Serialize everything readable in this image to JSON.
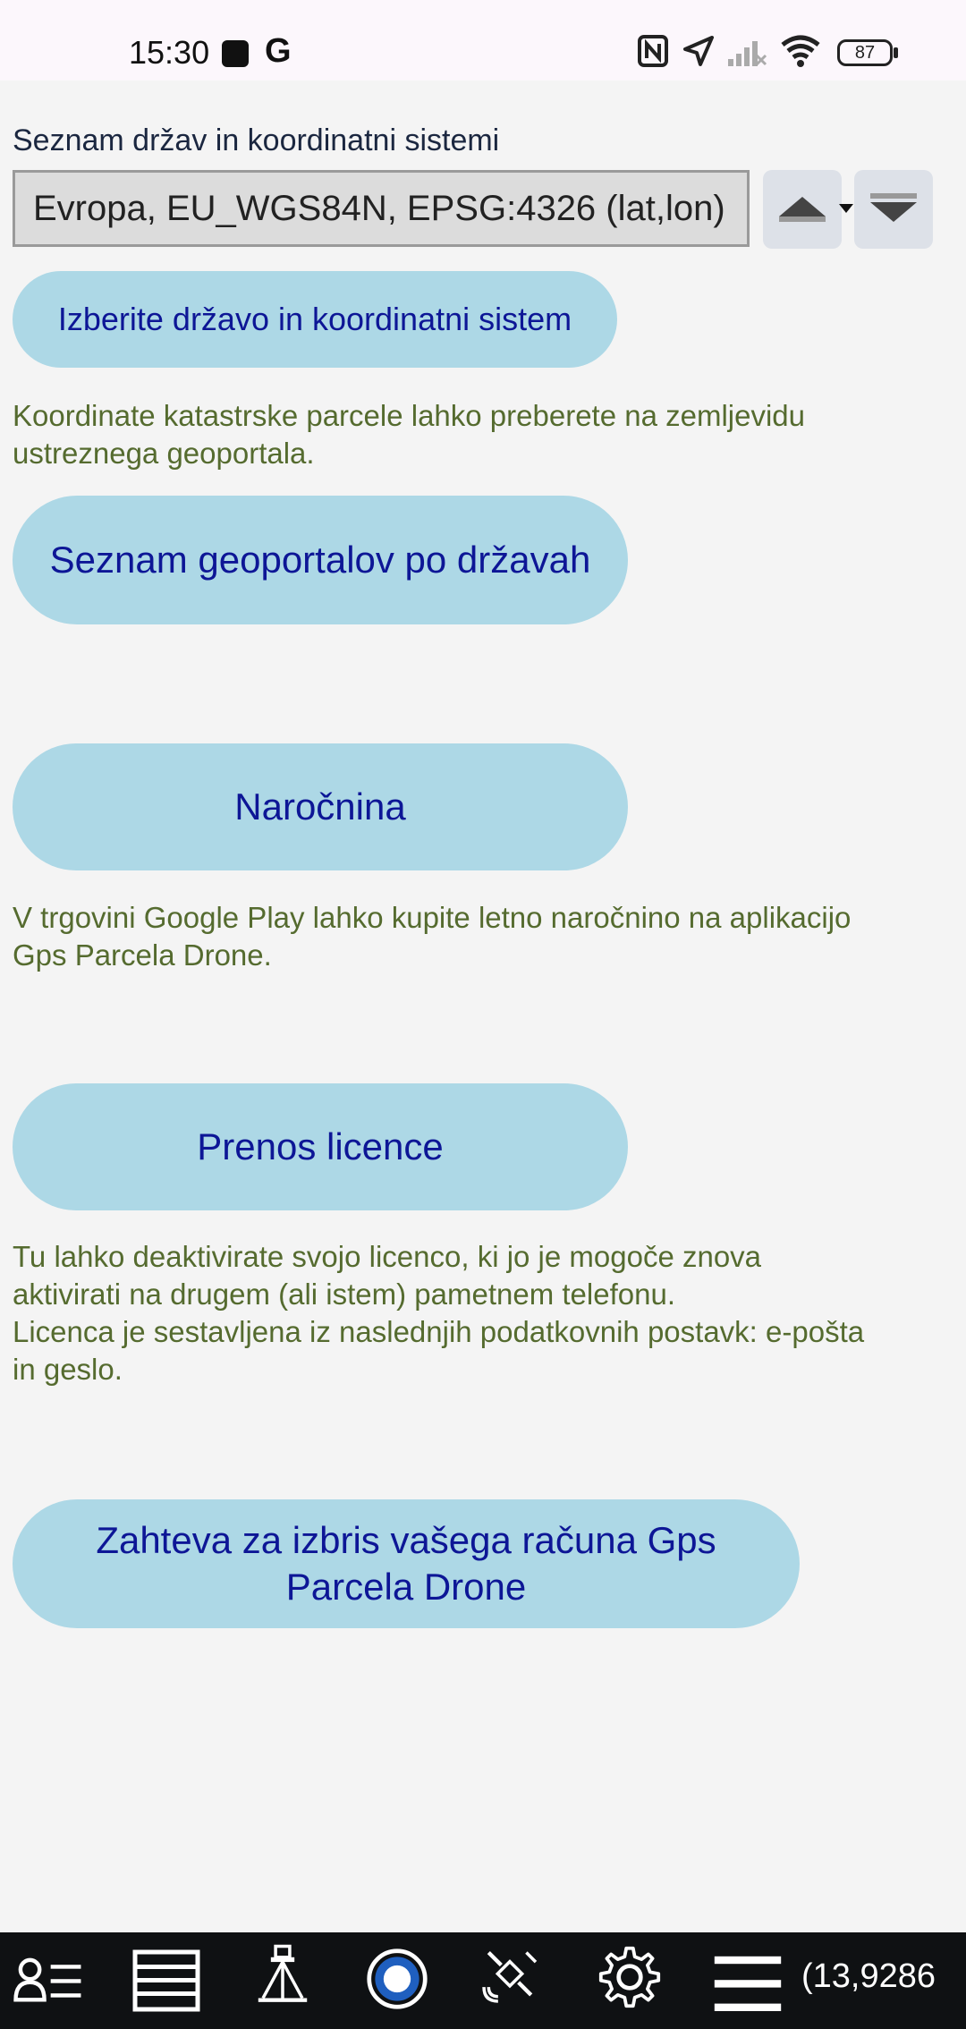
{
  "status_bar": {
    "time": "15:30",
    "g_label": "G",
    "battery": "87",
    "icons": [
      "nfc-icon",
      "location-arrow-icon",
      "no-signal-icon",
      "wifi-icon",
      "battery-icon"
    ]
  },
  "settings": {
    "country_label": "Seznam držav in koordinatni sistemi",
    "country_select_value": "Evropa, EU_WGS84N, EPSG:4326 (lat,lon)",
    "select_button": "Izberite državo in koordinatni sistem",
    "geoportal_note": "Koordinate katastrske parcele lahko preberete na zemljevidu\nustreznega geoportala.",
    "geoportal_button": "Seznam geoportalov po državah",
    "subscription_button": "Naročnina",
    "subscription_note": "V trgovini Google Play lahko kupite letno naročnino na aplikacijo\nGps Parcela Drone.",
    "license_button": "Prenos licence",
    "license_note": "Tu lahko deaktivirate svojo licenco, ki jo je mogoče znova\naktivirati na drugem (ali istem) pametnem telefonu.\nLicenca je sestavljena iz naslednjih podatkovnih postavk: e-pošta\nin geslo.",
    "delete_account_button": "Zahteva za izbris vašega računa Gps Parcela Drone"
  },
  "bottom_nav": {
    "items": [
      "user-list-icon",
      "layers-list-icon",
      "survey-instrument-icon",
      "record-circle-icon",
      "satellite-icon",
      "gear-icon",
      "hamburger-menu-icon"
    ],
    "coords_text": "(13,9286"
  },
  "colors": {
    "pill_bg": "#add8e6",
    "pill_text": "#0d1696",
    "helper_text": "#556b2f",
    "bottom_bar": "#0f1113"
  }
}
